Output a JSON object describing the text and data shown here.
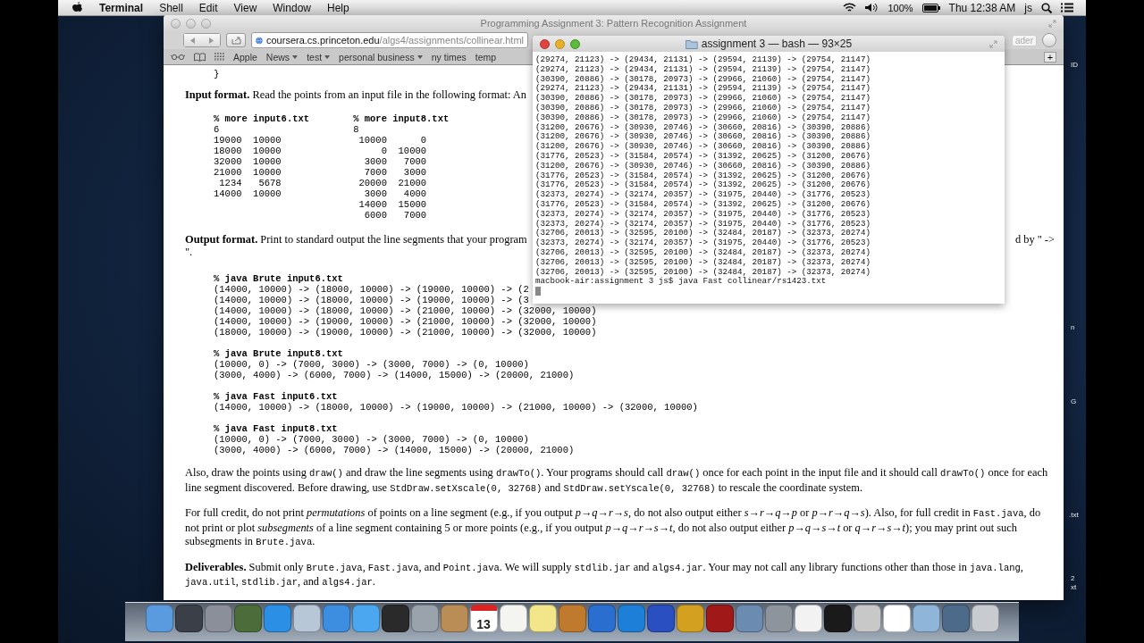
{
  "menu_bar": {
    "app": "Terminal",
    "menus": [
      "Shell",
      "Edit",
      "View",
      "Window",
      "Help"
    ],
    "battery": "100%",
    "clock": "Thu 12:38 AM",
    "user": "js"
  },
  "browser": {
    "title": "Programming Assignment 3: Pattern Recognition Assignment",
    "url": {
      "host": "coursera.cs.princeton.edu",
      "path": "/algs4/assignments/collinear.html"
    },
    "reader_button": "ader",
    "bookmarks": [
      {
        "label": "Apple",
        "menu": false
      },
      {
        "label": "News",
        "menu": true
      },
      {
        "label": "test",
        "menu": true
      },
      {
        "label": "personal business",
        "menu": true
      },
      {
        "label": "ny times",
        "menu": false
      },
      {
        "label": "temp",
        "menu": false
      }
    ],
    "new_tab": "+",
    "document": {
      "closing_brace": "}",
      "input_format": {
        "lead": "Input format.",
        "text": "Read the points from an input file in the following format: An"
      },
      "input_files": [
        {
          "command": "% more input6.txt",
          "count": "6",
          "rows": [
            "19000  10000",
            "18000  10000",
            "32000  10000",
            "21000  10000",
            " 1234   5678",
            "14000  10000"
          ]
        },
        {
          "command": "% more input8.txt",
          "count": "8",
          "rows": [
            " 10000      0",
            "     0  10000",
            "  3000   7000",
            "  7000   3000",
            " 20000  21000",
            "  3000   4000",
            " 14000  15000",
            "  6000   7000"
          ]
        }
      ],
      "output_format": {
        "lead": "Output format.",
        "text": "Print to standard output the line segments that your program",
        "tail": "d by \" ->",
        "continuation": "\"."
      },
      "samples": [
        {
          "command": "% java Brute input6.txt",
          "lines": [
            "(14000, 10000) -> (18000, 10000) -> (19000, 10000) -> (2",
            "(14000, 10000) -> (18000, 10000) -> (19000, 10000) -> (3",
            "(14000, 10000) -> (18000, 10000) -> (21000, 10000) -> (32000, 10000)",
            "(14000, 10000) -> (19000, 10000) -> (21000, 10000) -> (32000, 10000)",
            "(18000, 10000) -> (19000, 10000) -> (21000, 10000) -> (32000, 10000)"
          ]
        },
        {
          "command": "% java Brute input8.txt",
          "lines": [
            "(10000, 0) -> (7000, 3000) -> (3000, 7000) -> (0, 10000)",
            "(3000, 4000) -> (6000, 7000) -> (14000, 15000) -> (20000, 21000)"
          ]
        },
        {
          "command": "% java Fast input6.txt",
          "lines": [
            "(14000, 10000) -> (18000, 10000) -> (19000, 10000) -> (21000, 10000) -> (32000, 10000)"
          ]
        },
        {
          "command": "% java Fast input8.txt",
          "lines": [
            "(10000, 0) -> (7000, 3000) -> (3000, 7000) -> (0, 10000)",
            "(3000, 4000) -> (6000, 7000) -> (14000, 15000) -> (20000, 21000)"
          ]
        }
      ],
      "paragraphs": [
        {
          "segments": [
            {
              "kind": "text",
              "text": "Also, draw the points using "
            },
            {
              "kind": "code",
              "text": "draw()"
            },
            {
              "kind": "text",
              "text": " and draw the line segments using "
            },
            {
              "kind": "code",
              "text": "drawTo()"
            },
            {
              "kind": "text",
              "text": ". Your programs should call "
            },
            {
              "kind": "code",
              "text": "draw()"
            },
            {
              "kind": "text",
              "text": " once for each point in the input file and it should call "
            },
            {
              "kind": "code",
              "text": "drawTo()"
            },
            {
              "kind": "text",
              "text": " once for each line segment discovered. Before drawing, use "
            },
            {
              "kind": "code",
              "text": "StdDraw.setXscale(0, 32768)"
            },
            {
              "kind": "text",
              "text": " and "
            },
            {
              "kind": "code",
              "text": "StdDraw.setYscale(0, 32768)"
            },
            {
              "kind": "text",
              "text": " to rescale the coordinate system."
            }
          ]
        },
        {
          "segments": [
            {
              "kind": "text",
              "text": "For full credit, do not print "
            },
            {
              "kind": "italic",
              "text": "permutations"
            },
            {
              "kind": "text",
              "text": " of points on a line segment (e.g., if you output "
            },
            {
              "kind": "italic",
              "text": "p→q→r→s"
            },
            {
              "kind": "text",
              "text": ", do not also output either "
            },
            {
              "kind": "italic",
              "text": "s→r→q→p"
            },
            {
              "kind": "text",
              "text": " or "
            },
            {
              "kind": "italic",
              "text": "p→r→q→s"
            },
            {
              "kind": "text",
              "text": "). Also, for full credit in "
            },
            {
              "kind": "code",
              "text": "Fast.java"
            },
            {
              "kind": "text",
              "text": ", do not print or plot "
            },
            {
              "kind": "italic",
              "text": "subsegments"
            },
            {
              "kind": "text",
              "text": " of a line segment containing 5 or more points (e.g., if you output "
            },
            {
              "kind": "italic",
              "text": "p→q→r→s→t"
            },
            {
              "kind": "text",
              "text": ", do not also output either "
            },
            {
              "kind": "italic",
              "text": "p→q→s→t"
            },
            {
              "kind": "text",
              "text": " or "
            },
            {
              "kind": "italic",
              "text": "q→r→s→t"
            },
            {
              "kind": "text",
              "text": "); you may print out such subsegments in "
            },
            {
              "kind": "code",
              "text": "Brute.java"
            },
            {
              "kind": "text",
              "text": "."
            }
          ]
        },
        {
          "segments": [
            {
              "kind": "bold",
              "text": "Deliverables."
            },
            {
              "kind": "text",
              "text": " Submit only "
            },
            {
              "kind": "code",
              "text": "Brute.java"
            },
            {
              "kind": "text",
              "text": ", "
            },
            {
              "kind": "code",
              "text": "Fast.java"
            },
            {
              "kind": "text",
              "text": ", and "
            },
            {
              "kind": "code",
              "text": "Point.java"
            },
            {
              "kind": "text",
              "text": ". We will supply "
            },
            {
              "kind": "code",
              "text": "stdlib.jar"
            },
            {
              "kind": "text",
              "text": " and "
            },
            {
              "kind": "code",
              "text": "algs4.jar"
            },
            {
              "kind": "text",
              "text": ". Your may not call any library functions other than those in "
            },
            {
              "kind": "code",
              "text": "java.lang"
            },
            {
              "kind": "text",
              "text": ", "
            },
            {
              "kind": "code",
              "text": "java.util"
            },
            {
              "kind": "text",
              "text": ", "
            },
            {
              "kind": "code",
              "text": "stdlib.jar"
            },
            {
              "kind": "text",
              "text": ", and "
            },
            {
              "kind": "code",
              "text": "algs4.jar"
            },
            {
              "kind": "text",
              "text": "."
            }
          ]
        }
      ]
    }
  },
  "terminal": {
    "title": "assignment 3 — bash — 93×25",
    "lines": [
      "(29274, 21123) -> (29434, 21131) -> (29594, 21139) -> (29754, 21147)",
      "(29274, 21123) -> (29434, 21131) -> (29594, 21139) -> (29754, 21147)",
      "(30390, 20886) -> (30178, 20973) -> (29966, 21060) -> (29754, 21147)",
      "(29274, 21123) -> (29434, 21131) -> (29594, 21139) -> (29754, 21147)",
      "(30390, 20886) -> (30178, 20973) -> (29966, 21060) -> (29754, 21147)",
      "(30390, 20886) -> (30178, 20973) -> (29966, 21060) -> (29754, 21147)",
      "(30390, 20886) -> (30178, 20973) -> (29966, 21060) -> (29754, 21147)",
      "(31200, 20676) -> (30930, 20746) -> (30660, 20816) -> (30390, 20886)",
      "(31200, 20676) -> (30930, 20746) -> (30660, 20816) -> (30390, 20886)",
      "(31200, 20676) -> (30930, 20746) -> (30660, 20816) -> (30390, 20886)",
      "(31776, 20523) -> (31584, 20574) -> (31392, 20625) -> (31200, 20676)",
      "(31200, 20676) -> (30930, 20746) -> (30660, 20816) -> (30390, 20886)",
      "(31776, 20523) -> (31584, 20574) -> (31392, 20625) -> (31200, 20676)",
      "(31776, 20523) -> (31584, 20574) -> (31392, 20625) -> (31200, 20676)",
      "(32373, 20274) -> (32174, 20357) -> (31975, 20440) -> (31776, 20523)",
      "(31776, 20523) -> (31584, 20574) -> (31392, 20625) -> (31200, 20676)",
      "(32373, 20274) -> (32174, 20357) -> (31975, 20440) -> (31776, 20523)",
      "(32373, 20274) -> (32174, 20357) -> (31975, 20440) -> (31776, 20523)",
      "(32706, 20013) -> (32595, 20100) -> (32484, 20187) -> (32373, 20274)",
      "(32373, 20274) -> (32174, 20357) -> (31975, 20440) -> (31776, 20523)",
      "(32706, 20013) -> (32595, 20100) -> (32484, 20187) -> (32373, 20274)",
      "(32706, 20013) -> (32595, 20100) -> (32484, 20187) -> (32373, 20274)",
      "(32706, 20013) -> (32595, 20100) -> (32484, 20187) -> (32373, 20274)"
    ],
    "prompt": "macbook-air:assignment 3 js$ java Fast collinear/rs1423.txt"
  },
  "desktop_labels": [
    "ID",
    "n",
    "G",
    ".txt",
    "2",
    "xt"
  ],
  "dock": {
    "calendar_day": "13"
  }
}
